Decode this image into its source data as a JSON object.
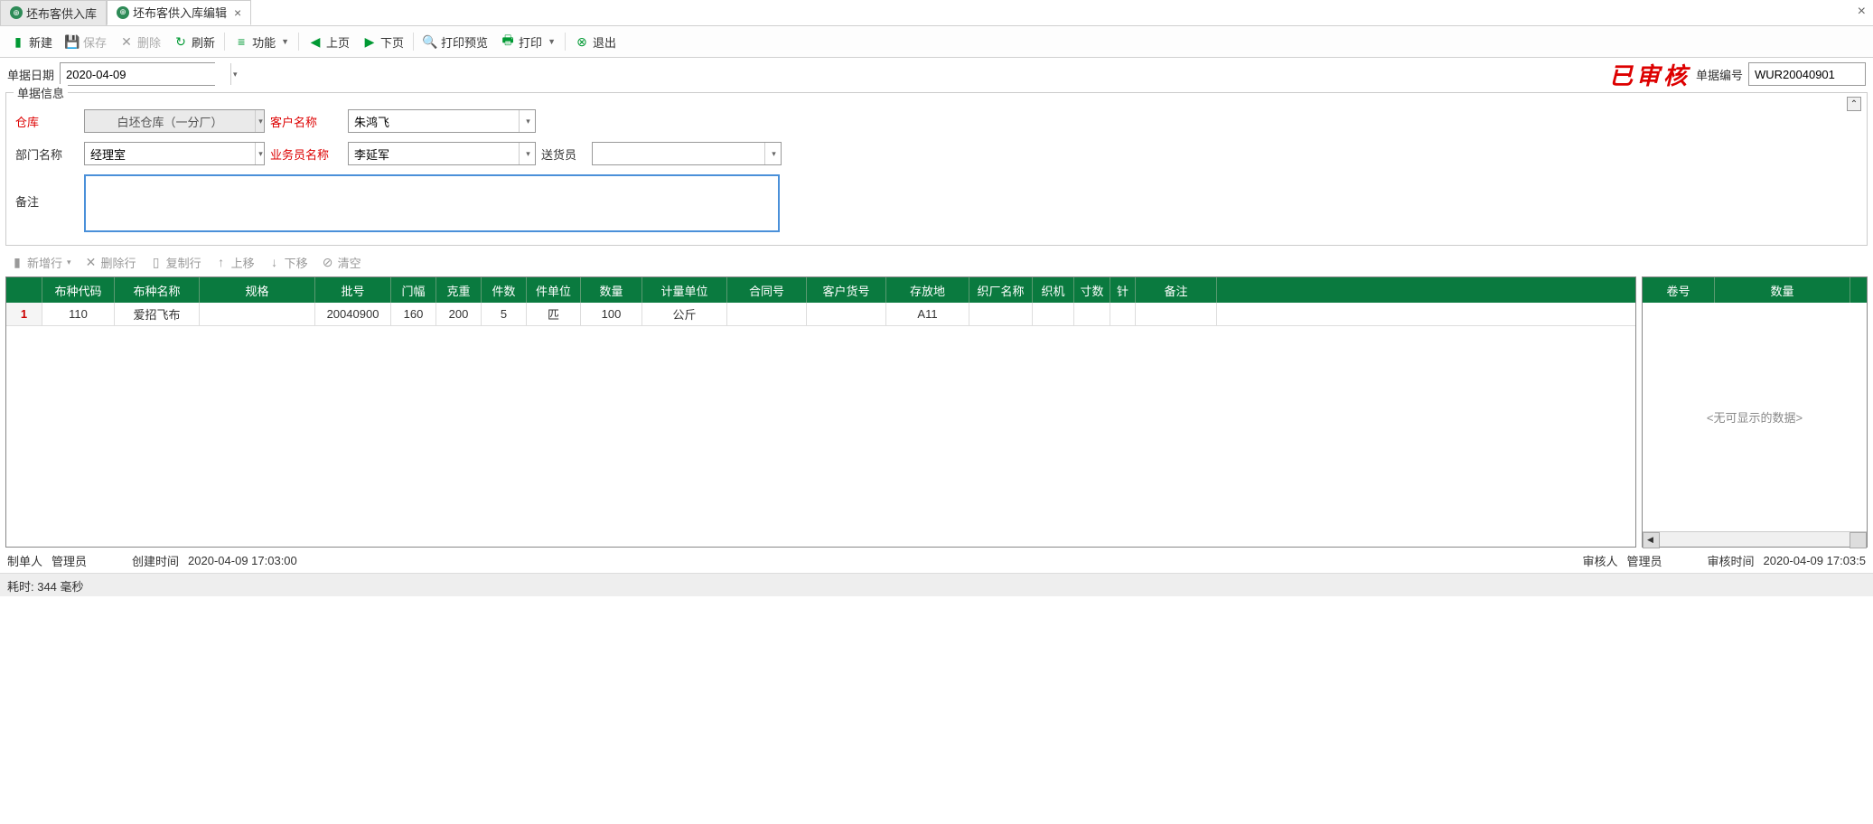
{
  "tabs": [
    {
      "label": "坯布客供入库",
      "active": false
    },
    {
      "label": "坯布客供入库编辑",
      "active": true
    }
  ],
  "toolbar": {
    "new": "新建",
    "save": "保存",
    "delete": "删除",
    "refresh": "刷新",
    "function": "功能",
    "prev": "上页",
    "next": "下页",
    "preview": "打印预览",
    "print": "打印",
    "exit": "退出"
  },
  "dateBar": {
    "dateLabel": "单据日期",
    "dateValue": "2020-04-09",
    "approvedStamp": "已审核",
    "docNoLabel": "单据编号",
    "docNoValue": "WUR20040901"
  },
  "infoSection": {
    "legend": "单据信息",
    "warehouseLabel": "仓库",
    "warehouseValue": "白坯仓库（一分厂）",
    "customerLabel": "客户名称",
    "customerValue": "朱鸿飞",
    "deptLabel": "部门名称",
    "deptValue": "经理室",
    "salesmanLabel": "业务员名称",
    "salesmanValue": "李延军",
    "delivererLabel": "送货员",
    "delivererValue": "",
    "remarkLabel": "备注",
    "remarkValue": ""
  },
  "gridToolbar": {
    "addRow": "新增行",
    "delRow": "删除行",
    "copyRow": "复制行",
    "moveUp": "上移",
    "moveDown": "下移",
    "clear": "清空"
  },
  "mainGrid": {
    "headers": {
      "code": "布种代码",
      "name": "布种名称",
      "spec": "规格",
      "lot": "批号",
      "width": "门幅",
      "weight": "克重",
      "pcs": "件数",
      "punit": "件单位",
      "qty": "数量",
      "munit": "计量单位",
      "contract": "合同号",
      "custno": "客户货号",
      "loc": "存放地",
      "factory": "织厂名称",
      "machine": "织机",
      "inch": "寸数",
      "needle": "针",
      "remark": "备注"
    },
    "rows": [
      {
        "rn": "1",
        "code": "110",
        "name": "爱招飞布",
        "spec": "",
        "lot": "20040900",
        "width": "160",
        "weight": "200",
        "pcs": "5",
        "punit": "匹",
        "qty": "100",
        "munit": "公斤",
        "contract": "",
        "custno": "",
        "loc": "A11",
        "factory": "",
        "machine": "",
        "inch": "",
        "needle": "",
        "remark": ""
      }
    ]
  },
  "sideGrid": {
    "headers": {
      "roll": "卷号",
      "qty": "数量"
    },
    "emptyText": "<无可显示的数据>"
  },
  "footer": {
    "creatorLabel": "制单人",
    "creatorValue": "管理员",
    "createTimeLabel": "创建时间",
    "createTimeValue": "2020-04-09 17:03:00",
    "approverLabel": "审核人",
    "approverValue": "管理员",
    "approveTimeLabel": "审核时间",
    "approveTimeValue": "2020-04-09 17:03:5"
  },
  "statusBar": {
    "text": "耗时: 344 毫秒"
  }
}
